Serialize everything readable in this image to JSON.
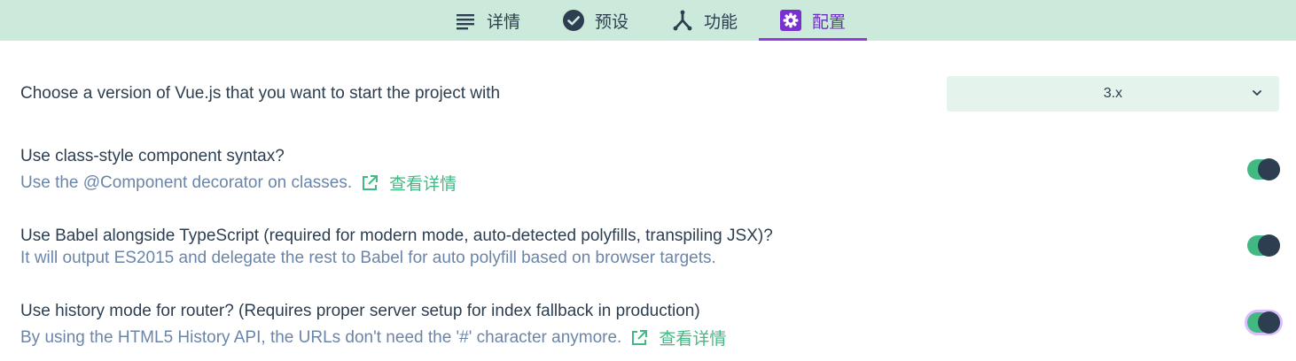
{
  "tabs": [
    {
      "label": "详情",
      "icon": "list-icon",
      "active": false
    },
    {
      "label": "预设",
      "icon": "check-circle-icon",
      "active": false
    },
    {
      "label": "功能",
      "icon": "fork-icon",
      "active": false
    },
    {
      "label": "配置",
      "icon": "gear-icon",
      "active": true
    }
  ],
  "vue_version": {
    "question": "Choose a version of Vue.js that you want to start the project with",
    "selected": "3.x"
  },
  "options": [
    {
      "question": "Use class-style component syntax?",
      "description": "Use the @Component decorator on classes.",
      "link_label": "查看详情",
      "enabled": true
    },
    {
      "question": "Use Babel alongside TypeScript (required for modern mode, auto-detected polyfills, transpiling JSX)?",
      "description": "It will output ES2015 and delegate the rest to Babel for auto polyfill based on browser targets.",
      "enabled": true
    },
    {
      "question": "Use history mode for router? (Requires proper server setup for index fallback in production)",
      "description": "By using the HTML5 History API, the URLs don't need the '#' character anymore.",
      "link_label": "查看详情",
      "enabled": true
    }
  ],
  "colors": {
    "tabbar_bg": "#cbeadc",
    "accent_green": "#42b983",
    "accent_purple": "#8e3fdc",
    "text_dark": "#2c3e50",
    "text_muted": "#6b85a8"
  }
}
